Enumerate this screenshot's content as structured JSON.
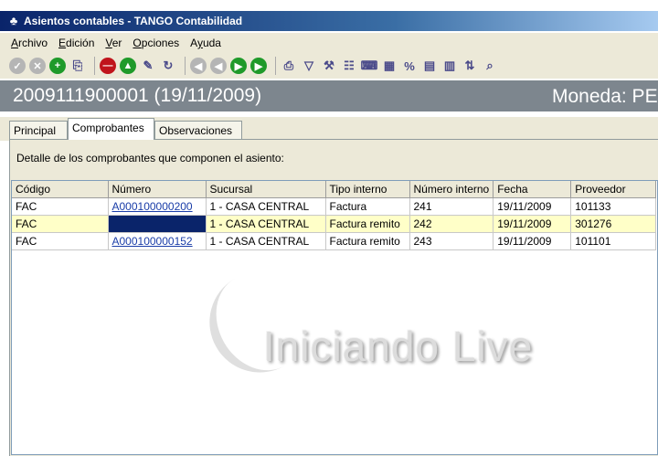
{
  "window": {
    "title": "Asientos contables - TANGO Contabilidad"
  },
  "menu": [
    {
      "label": "Archivo",
      "key": "A"
    },
    {
      "label": "Edición",
      "key": "E"
    },
    {
      "label": "Ver",
      "key": "V"
    },
    {
      "label": "Opciones",
      "key": "O"
    },
    {
      "label": "Ayuda",
      "key": "y"
    }
  ],
  "toolbar_icons": [
    "check-icon",
    "cancel-icon",
    "add-icon",
    "copy-icon",
    "delete-icon",
    "up-icon",
    "notes-icon",
    "refresh-icon",
    "first-icon",
    "previous-icon",
    "next-icon",
    "last-icon",
    "print-icon",
    "filter-icon",
    "tools-icon",
    "report-icon",
    "calc-icon",
    "chart-icon",
    "percent-icon",
    "grid-icon",
    "table-icon",
    "sort-icon",
    "preview-icon"
  ],
  "header": {
    "entry": "2009111900001 (19/11/2009)",
    "currency": "Moneda: PE"
  },
  "tabs": [
    "Principal",
    "Comprobantes",
    "Observaciones"
  ],
  "active_tab": "Comprobantes",
  "description": "Detalle de los comprobantes que componen el asiento:",
  "grid": {
    "columns": [
      "Código",
      "Número",
      "Sucursal",
      "Tipo interno",
      "Número interno",
      "Fecha",
      "Proveedor"
    ],
    "rows": [
      [
        "FAC",
        "A000100000200",
        "1 - CASA CENTRAL",
        "Factura",
        "241",
        "19/11/2009",
        "101133"
      ],
      [
        "FAC",
        "",
        "1 - CASA CENTRAL",
        "Factura remito",
        "242",
        "19/11/2009",
        "301276"
      ],
      [
        "FAC",
        "A000100000152",
        "1 - CASA CENTRAL",
        "Factura remito",
        "243",
        "19/11/2009",
        "101101"
      ]
    ],
    "selected_row": 1
  },
  "watermark": "Iniciando Live"
}
